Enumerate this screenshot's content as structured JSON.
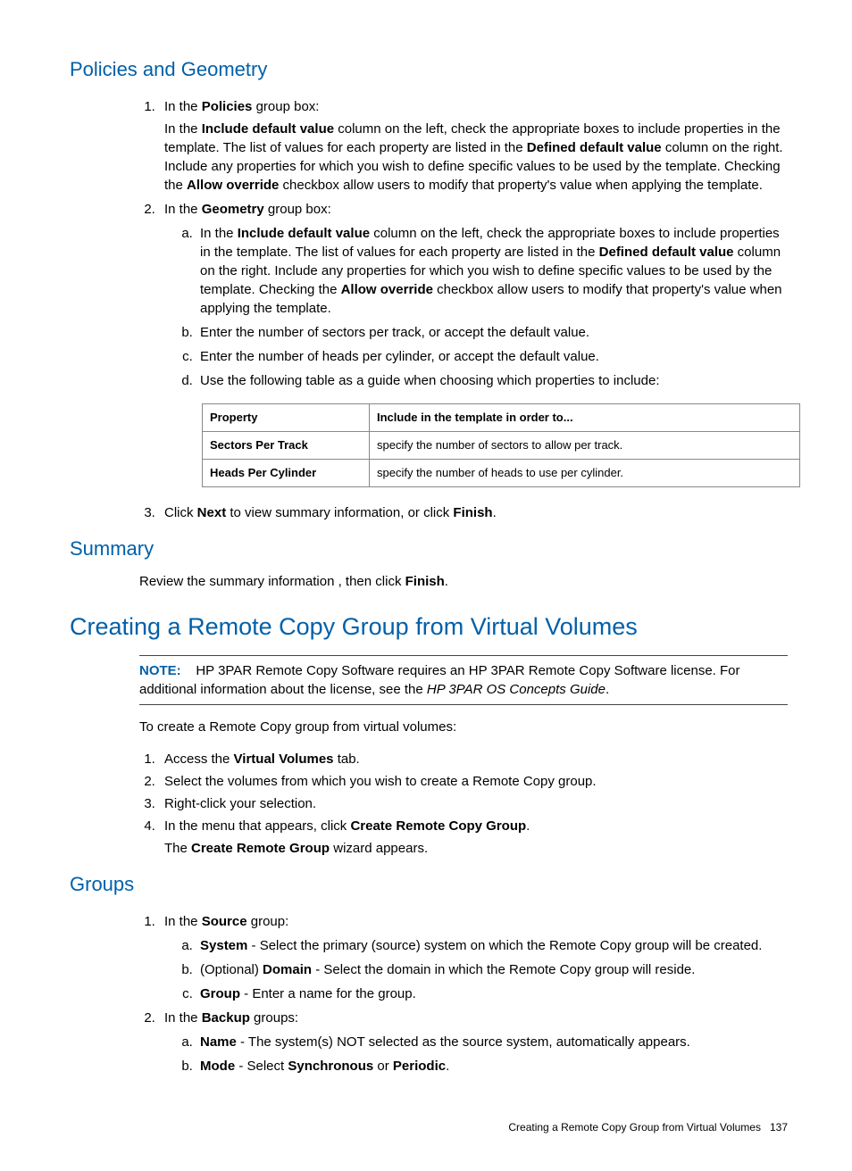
{
  "h_policies": "Policies and Geometry",
  "p1_intro": "In the ",
  "p1_b1": "Policies",
  "p1_rest": " group box:",
  "p1_para_a": "In the ",
  "p1_para_b1": "Include default value",
  "p1_para_c": " column on the left, check the appropriate boxes to include properties in the template. The list of values for each property are listed in the ",
  "p1_para_b2": "Defined default value",
  "p1_para_d": " column on the right. Include any properties for which you wish to define specific values to be used by the template. Checking the ",
  "p1_para_b3": "Allow override",
  "p1_para_e": " checkbox allow users to modify that property's value when applying the template.",
  "p2_intro": "In the ",
  "p2_b1": "Geometry",
  "p2_rest": " group box:",
  "p2a_a": "In the ",
  "p2a_b1": "Include default value",
  "p2a_c": " column on the left, check the appropriate boxes to include properties in the template. The list of values for each property are listed in the ",
  "p2a_b2": "Defined default value",
  "p2a_d": " column on the right. Include any properties for which you wish to define specific values to be used by the template. Checking the ",
  "p2a_b3": "Allow override",
  "p2a_e": " checkbox allow users to modify that property's value when applying the template.",
  "p2b": "Enter the number of sectors per track, or accept the default value.",
  "p2c": "Enter the number of heads per cylinder, or accept the default value.",
  "p2d": "Use the following table as a guide when choosing which properties to include:",
  "th1": "Property",
  "th2": "Include in the template in order to...",
  "r1c1": "Sectors Per Track",
  "r1c2": "specify the number of sectors to allow per track.",
  "r2c1": "Heads Per Cylinder",
  "r2c2": "specify the number of heads to use per cylinder.",
  "p3_a": "Click ",
  "p3_b1": "Next",
  "p3_b": " to view summary information, or click ",
  "p3_b2": "Finish",
  "p3_c": ".",
  "h_summary": "Summary",
  "sum_a": "Review the summary information , then click ",
  "sum_b": "Finish",
  "sum_c": ".",
  "h_creating": "Creating a Remote Copy Group from Virtual Volumes",
  "note_label": "NOTE:",
  "note_a": "HP 3PAR Remote Copy Software requires an HP 3PAR Remote Copy Software license. For additional information about the license, see the ",
  "note_i": "HP 3PAR OS Concepts Guide",
  "note_c": ".",
  "create_intro": "To create a Remote Copy group from virtual volumes:",
  "c1_a": "Access the ",
  "c1_b": "Virtual Volumes",
  "c1_c": " tab.",
  "c2": "Select the volumes from which you wish to create a Remote Copy group.",
  "c3": "Right-click your selection.",
  "c4_a": "In the menu that appears, click ",
  "c4_b": "Create Remote Copy Group",
  "c4_c": ".",
  "c4_sub_a": "The ",
  "c4_sub_b": "Create Remote Group",
  "c4_sub_c": " wizard appears.",
  "h_groups": "Groups",
  "g1_a": "In the ",
  "g1_b": "Source",
  "g1_c": " group:",
  "g1a_b": "System",
  "g1a_t": " - Select the primary (source) system on which the Remote Copy group will be created.",
  "g1b_a": "(Optional) ",
  "g1b_b": "Domain",
  "g1b_t": " - Select the domain in which the Remote Copy group will reside.",
  "g1c_b": "Group",
  "g1c_t": " - Enter a name for the group.",
  "g2_a": "In the ",
  "g2_b": "Backup",
  "g2_c": " groups:",
  "g2a_b": "Name",
  "g2a_t": " - The system(s) NOT selected as the source system, automatically appears.",
  "g2b_b": "Mode",
  "g2b_t": " - Select ",
  "g2b_b2": "Synchronous",
  "g2b_t2": " or ",
  "g2b_b3": "Periodic",
  "g2b_t3": ".",
  "footer_text": "Creating a Remote Copy Group from Virtual Volumes",
  "footer_page": "137"
}
